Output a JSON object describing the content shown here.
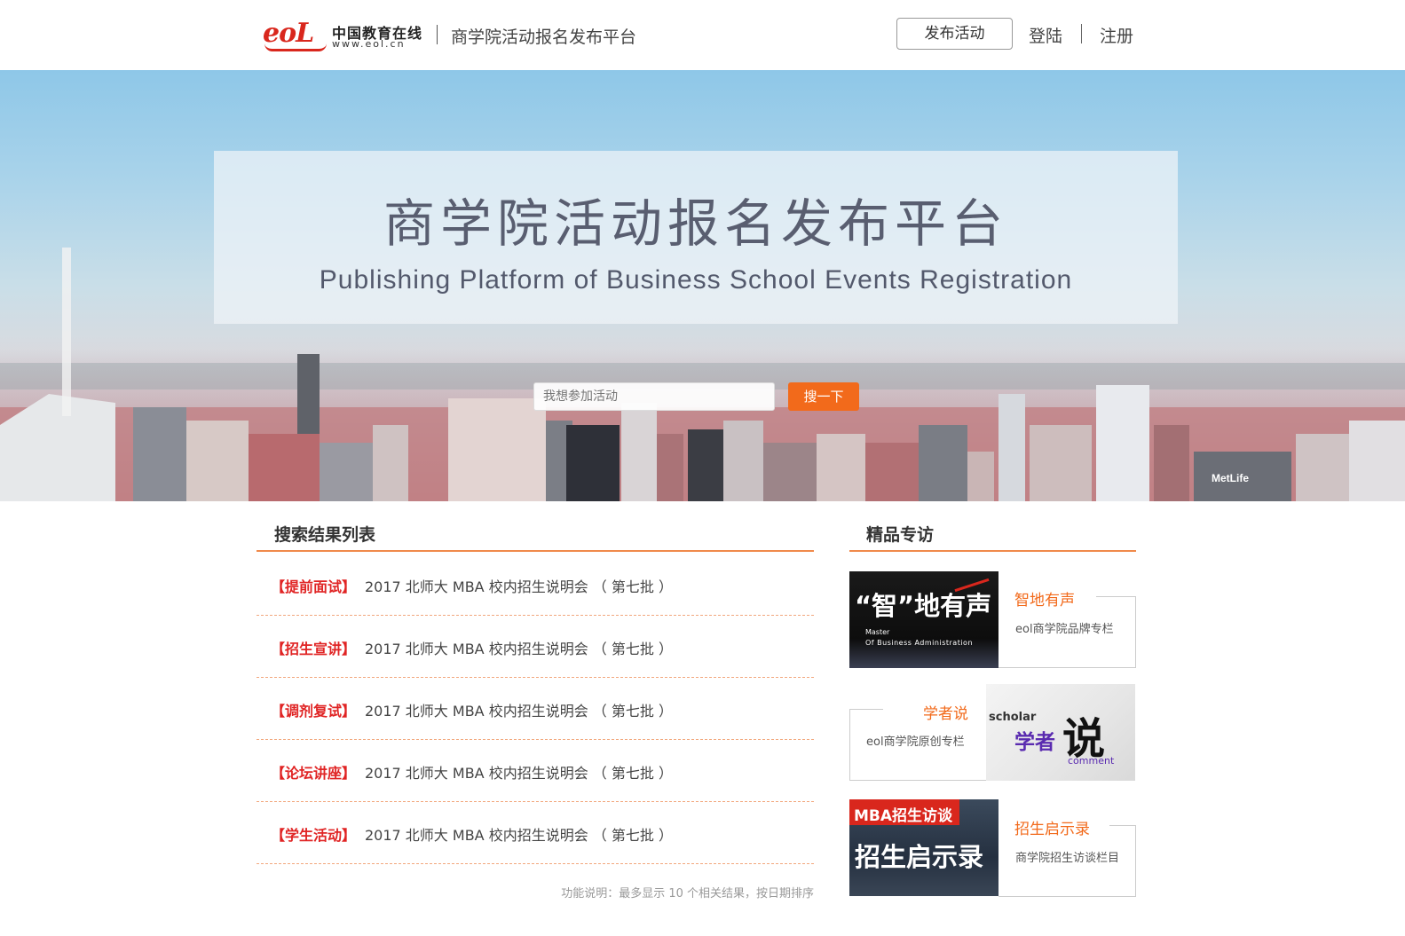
{
  "header": {
    "logo_mark": "eoL",
    "logo_cn": "中国教育在线",
    "logo_url": "www.eol.cn",
    "title": "商学院活动报名发布平台",
    "publish_label": "发布活动",
    "login_label": "登陆",
    "register_label": "注册"
  },
  "banner": {
    "title": "商学院活动报名发布平台",
    "subtitle": "Publishing Platform of Business School Events Registration",
    "search_placeholder": "我想参加活动",
    "search_button": "搜一下"
  },
  "results": {
    "heading": "搜索结果列表",
    "items": [
      {
        "tag": "【提前面试】",
        "text": "2017 北师大 MBA 校内招生说明会 （ 第七批 ）"
      },
      {
        "tag": "【招生宣讲】",
        "text": "2017 北师大 MBA 校内招生说明会 （ 第七批 ）"
      },
      {
        "tag": "【调剂复试】",
        "text": "2017 北师大 MBA 校内招生说明会 （ 第七批 ）"
      },
      {
        "tag": "【论坛讲座】",
        "text": "2017 北师大 MBA 校内招生说明会 （ 第七批 ）"
      },
      {
        "tag": "【学生活动】",
        "text": "2017 北师大 MBA 校内招生说明会 （ 第七批 ）"
      }
    ],
    "note": "功能说明：最多显示 10 个相关结果，按日期排序"
  },
  "featured": {
    "heading": "精品专访",
    "cards": [
      {
        "title": "智地有声",
        "desc": "eol商学院品牌专栏",
        "image_text_main": "“智”地有声",
        "image_text_sub1": "Master",
        "image_text_sub2": "Of Business Administration"
      },
      {
        "title": "学者说",
        "desc": "eol商学院原创专栏",
        "image_text_scholar": "scholar",
        "image_text_main1": "学者",
        "image_text_main2": "说",
        "image_text_comment": "comment"
      },
      {
        "title": "招生启示录",
        "desc": "商学院招生访谈栏目",
        "image_text_top": "MBA招生访谈",
        "image_text_main": "招生启示录"
      }
    ]
  },
  "colors": {
    "accent": "#f26a1b",
    "tag_red": "#e02424",
    "brand_red": "#d9271d"
  }
}
